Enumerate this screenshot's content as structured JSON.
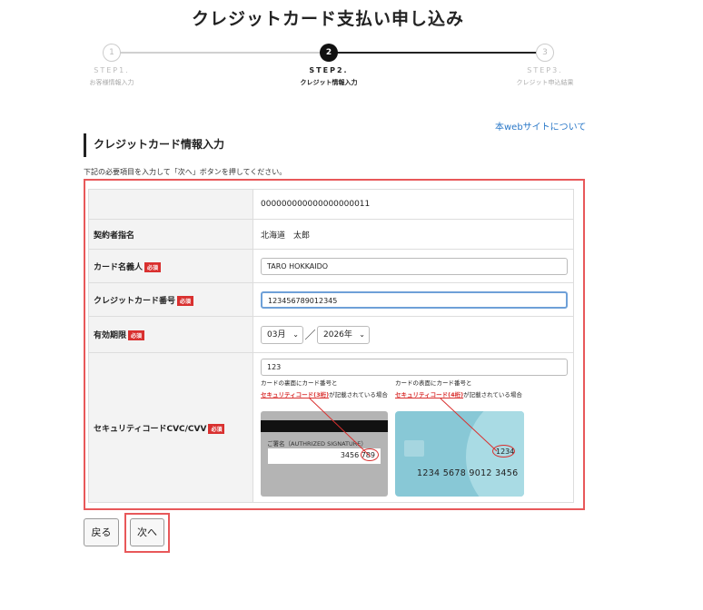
{
  "page": {
    "title": "クレジットカード支払い申し込み"
  },
  "stepper": {
    "steps": [
      {
        "number": "1",
        "label": "STEP1.",
        "sub": "お客様情報入力"
      },
      {
        "number": "2",
        "label": "STEP2.",
        "sub": "クレジット情報入力"
      },
      {
        "number": "3",
        "label": "STEP3.",
        "sub": "クレジット申込結果"
      }
    ],
    "current_step": 2
  },
  "links": {
    "site_link": "本webサイトについて"
  },
  "section": {
    "heading": "クレジットカード情報入力",
    "instruction": "下記の必要項目を入力して「次へ」ボタンを押してください。"
  },
  "form": {
    "required_badge": "必須",
    "id_value": "000000000000000000011",
    "contract_name_label": "契約者指名",
    "contract_name_value": "北海道　太郎",
    "card_holder_label": "カード名義人",
    "card_holder_value": "TARO HOKKAIDO",
    "card_number_label": "クレジットカード番号",
    "card_number_value": "123456789012345",
    "expiry_label": "有効期限",
    "expiry_month": "03月",
    "expiry_separator": "／",
    "expiry_year": "2026年",
    "security_label": "セキュリティコードCVC/CVV",
    "security_value": "123",
    "note_back_line1": "カードの裏面にカード番号と",
    "note_back_red": "セキュリティコード(3桁)",
    "note_back_line2": "が記載されている場合",
    "note_front_line1": "カードの表面にカード番号と",
    "note_front_red": "セキュリティコード(4桁)",
    "note_front_line2": "が記載されている場合",
    "back_card": {
      "signature_label": "ご署名（AUTHRIZED SIGNATURE）",
      "number_prefix": "3456",
      "code": "789"
    },
    "front_card": {
      "code": "1234",
      "number": "1234 5678 9012 3456"
    }
  },
  "buttons": {
    "back": "戻る",
    "next": "次へ"
  },
  "colors": {
    "accent_red": "#d9302f",
    "highlight_outline": "#e8585a",
    "link_blue": "#2a78c8",
    "focus_blue": "#6ea0d8",
    "card_teal": "#88c8d6"
  }
}
